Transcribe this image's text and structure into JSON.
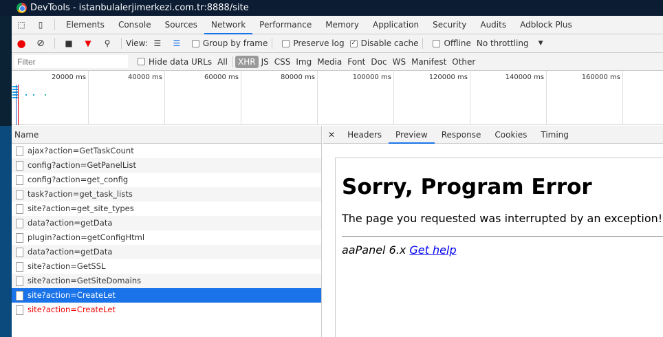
{
  "window": {
    "title": "DevTools - istanbulalerjimerkezi.com.tr:8888/site"
  },
  "tabs": [
    "Elements",
    "Console",
    "Sources",
    "Network",
    "Performance",
    "Memory",
    "Application",
    "Security",
    "Audits",
    "Adblock Plus"
  ],
  "toolbar": {
    "view_label": "View:",
    "group_by_frame": "Group by frame",
    "preserve_log": "Preserve log",
    "disable_cache": "Disable cache",
    "offline": "Offline",
    "throttling": "No throttling"
  },
  "filterbar": {
    "placeholder": "Filter",
    "hide_data_urls": "Hide data URLs",
    "types": [
      "All",
      "XHR",
      "JS",
      "CSS",
      "Img",
      "Media",
      "Font",
      "Doc",
      "WS",
      "Manifest",
      "Other"
    ]
  },
  "overview_ticks": [
    "20000 ms",
    "40000 ms",
    "60000 ms",
    "80000 ms",
    "100000 ms",
    "120000 ms",
    "140000 ms",
    "160000 ms"
  ],
  "list": {
    "header": "Name",
    "items": [
      "ajax?action=GetTaskCount",
      "config?action=GetPanelList",
      "config?action=get_config",
      "task?action=get_task_lists",
      "site?action=get_site_types",
      "data?action=getData",
      "plugin?action=getConfigHtml",
      "data?action=getData",
      "site?action=GetSSL",
      "site?action=GetSiteDomains",
      "site?action=CreateLet",
      "site?action=CreateLet"
    ]
  },
  "detail_tabs": [
    "Headers",
    "Preview",
    "Response",
    "Cookies",
    "Timing"
  ],
  "preview": {
    "heading": "Sorry, Program Error",
    "message": "The page you requested was interrupted by an exception!",
    "footer": "aaPanel 6.x",
    "link": "Get help"
  }
}
